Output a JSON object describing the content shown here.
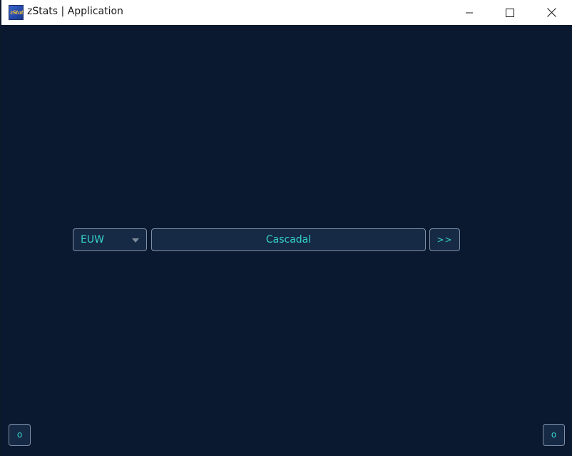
{
  "window": {
    "title": "zStats | Application",
    "icon": "zstats-app-icon",
    "icon_text": "zStats"
  },
  "search": {
    "region": "EUW",
    "summoner_value": "Cascadal",
    "submit_label": ">>"
  },
  "corner_buttons": {
    "left_label": "o",
    "right_label": "o"
  },
  "colors": {
    "background": "#0a1930",
    "control_fill": "#162a46",
    "control_border": "#7f8fa6",
    "accent_text": "#35d4c8",
    "titlebar": "#ffffff"
  }
}
